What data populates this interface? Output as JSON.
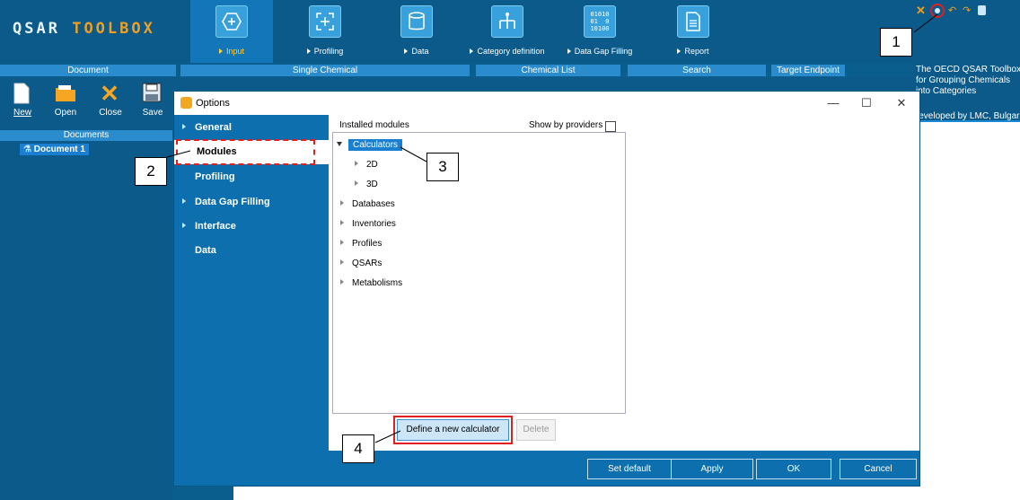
{
  "app": {
    "logo_q": "QSAR",
    "logo_t": "TOOLBOX"
  },
  "ribbon": {
    "tabs": [
      {
        "label": "Input",
        "active": true,
        "icon": "hexagon-plus-icon"
      },
      {
        "label": "Profiling",
        "icon": "focus-frame-icon"
      },
      {
        "label": "Data",
        "icon": "database-icon"
      },
      {
        "label": "Category definition",
        "icon": "hierarchy-icon"
      },
      {
        "label": "Data Gap Filling",
        "icon": "binary-icon",
        "icon_text": "01010\n01  0\n10100"
      },
      {
        "label": "Report",
        "icon": "report-icon"
      }
    ],
    "sections": {
      "document": "Document",
      "single_chemical": "Single Chemical",
      "chemical_list": "Chemical List",
      "search": "Search",
      "target_endpoint": "Target Endpoint"
    },
    "doc_buttons": [
      "New",
      "Open",
      "Close",
      "Save"
    ]
  },
  "left_panel": {
    "header": "Documents",
    "item": "Document 1"
  },
  "info_text": {
    "line1": "The OECD QSAR Toolbox",
    "line2": "for Grouping Chemicals",
    "line3": "into Categories",
    "line4": "Developed by LMC, Bulgaria"
  },
  "dialog": {
    "title": "Options",
    "nav": [
      "General",
      "Modules",
      "Profiling",
      "Data Gap Filling",
      "Interface",
      "Data"
    ],
    "selected_nav": "Modules",
    "installed_label": "Installed modules",
    "show_by_providers": "Show by providers",
    "tree": {
      "calculators": "Calculators",
      "children": [
        "2D",
        "3D"
      ],
      "others": [
        "Databases",
        "Inventories",
        "Profiles",
        "QSARs",
        "Metabolisms"
      ]
    },
    "define_button": "Define a new calculator",
    "delete_button": "Delete",
    "footer": {
      "set_default": "Set default",
      "apply": "Apply",
      "ok": "OK",
      "cancel": "Cancel"
    }
  },
  "callouts": [
    "1",
    "2",
    "3",
    "4"
  ],
  "colors": {
    "accent": "#0d6fae",
    "selection": "#1a7fd0",
    "highlight_red": "#e02020",
    "logo_orange": "#f0a020"
  }
}
